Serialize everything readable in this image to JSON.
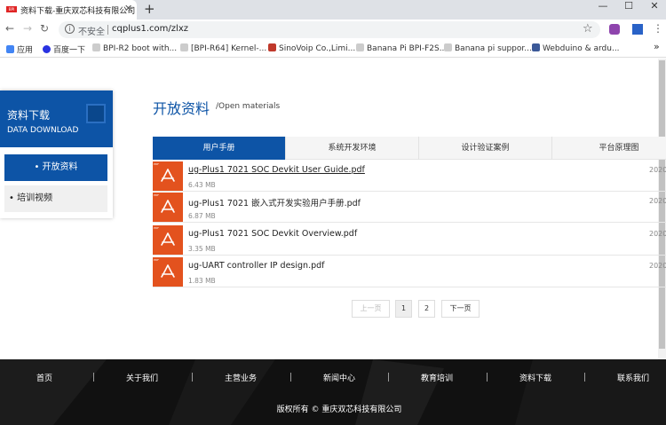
{
  "browser": {
    "tab_title": "资料下载-重庆双芯科技有限公司",
    "tab_favicon_text": "BPI",
    "security_label": "不安全",
    "url": "cqplus1.com/zlxz",
    "bookmarks": [
      {
        "label": "应用",
        "color": "#4285f4"
      },
      {
        "label": "百度一下",
        "color": "#2932e1"
      },
      {
        "label": "BPI-R2 boot with...",
        "color": "#888888"
      },
      {
        "label": "[BPI-R64] Kernel-...",
        "color": "#888888"
      },
      {
        "label": "SinoVoip Co.,Limi...",
        "color": "#c0392b"
      },
      {
        "label": "Banana Pi BPI-F2S...",
        "color": "#888888"
      },
      {
        "label": "Banana pi suppor...",
        "color": "#888888"
      },
      {
        "label": "Webduino & ardu...",
        "color": "#3b5998"
      }
    ]
  },
  "sidebar": {
    "title": "资料下载",
    "subtitle": "DATA DOWNLOAD",
    "items": [
      {
        "label": "开放资料"
      },
      {
        "label": "培训视频"
      }
    ]
  },
  "main": {
    "title": "开放资料",
    "subtitle": "/Open materials",
    "tabs": [
      {
        "label": "用户手册"
      },
      {
        "label": "系统开发环境"
      },
      {
        "label": "设计验证案例"
      },
      {
        "label": "平台原理图"
      }
    ],
    "files": [
      {
        "name": "ug-Plus1 7021 SOC Devkit User Guide.pdf",
        "size": "6.43 MB",
        "date": "2020"
      },
      {
        "name": "ug-Plus1 7021 嵌入式开发实验用户手册.pdf",
        "size": "6.87 MB",
        "date": "2020"
      },
      {
        "name": "ug-Plus1 7021 SOC Devkit Overview.pdf",
        "size": "3.35 MB",
        "date": "2020"
      },
      {
        "name": "ug-UART controller IP design.pdf",
        "size": "1.83 MB",
        "date": "2020"
      }
    ],
    "pagination": {
      "prev": "上一页",
      "pages": [
        "1",
        "2"
      ],
      "next": "下一页"
    }
  },
  "footer": {
    "nav": [
      "首页",
      "关于我们",
      "主营业务",
      "新闻中心",
      "教育培训",
      "资料下载",
      "联系我们"
    ],
    "copyright": "版权所有 © 重庆双芯科技有限公司"
  },
  "colors": {
    "brand_blue": "#0d54a6",
    "pdf_orange": "#e3521e"
  }
}
